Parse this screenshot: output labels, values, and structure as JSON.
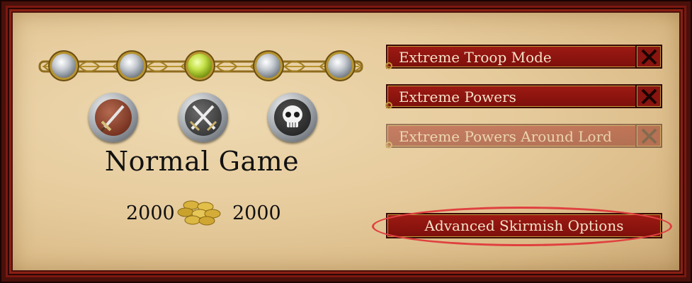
{
  "difficulty": {
    "title": "Normal Game",
    "levels": 5,
    "selected_index": 2
  },
  "icons": [
    "sword-icon",
    "crossed-swords-icon",
    "skull-icon"
  ],
  "gold": {
    "left": "2000",
    "right": "2000"
  },
  "options": [
    {
      "label": "Extreme Troop Mode",
      "enabled": true
    },
    {
      "label": "Extreme Powers",
      "enabled": true
    },
    {
      "label": "Extreme Powers Around Lord",
      "enabled": false
    }
  ],
  "advanced_button": "Advanced Skirmish Options",
  "colors": {
    "accent_red": "#8a1510",
    "gold_trim": "#c49a3a",
    "parchment": "#e6cb9c"
  }
}
